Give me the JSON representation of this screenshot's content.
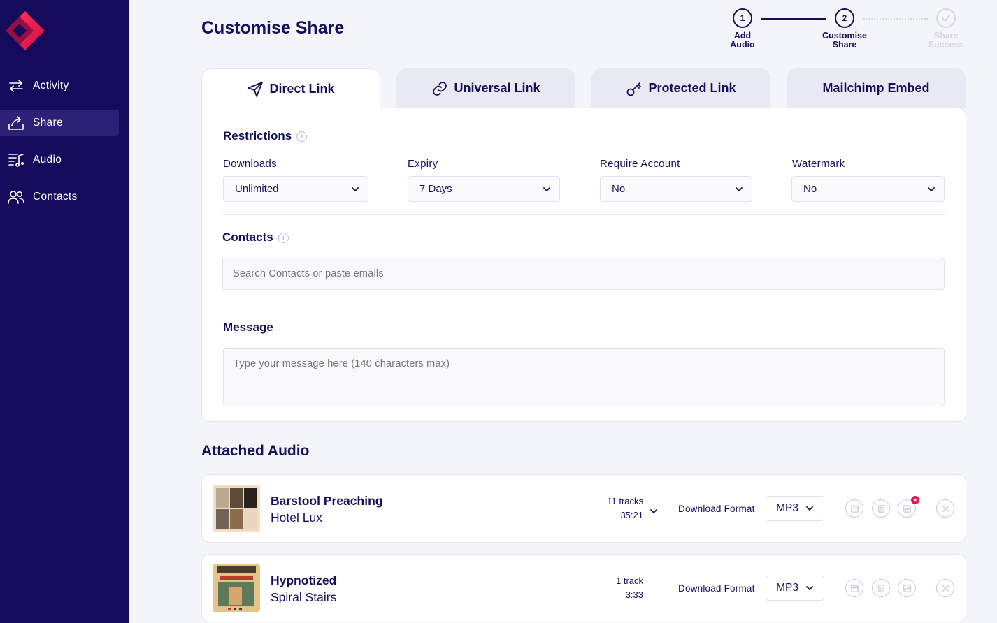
{
  "sidebar": {
    "items": [
      {
        "label": "Activity",
        "icon": "arrows-exchange-icon"
      },
      {
        "label": "Share",
        "icon": "share-tray-icon",
        "active": true
      },
      {
        "label": "Audio",
        "icon": "playlist-music-icon"
      },
      {
        "label": "Contacts",
        "icon": "users-icon"
      }
    ]
  },
  "header": {
    "title": "Customise Share"
  },
  "stepper": {
    "steps": [
      {
        "number": "1",
        "label_line1": "Add",
        "label_line2": "Audio",
        "state": "completed"
      },
      {
        "number": "2",
        "label_line1": "Customise",
        "label_line2": "Share",
        "state": "current"
      },
      {
        "number": "",
        "label_line1": "Share",
        "label_line2": "Success",
        "state": "upcoming"
      }
    ]
  },
  "tabs": [
    {
      "label": "Direct Link",
      "icon": "paper-plane-icon",
      "active": true
    },
    {
      "label": "Universal Link",
      "icon": "link-icon"
    },
    {
      "label": "Protected Link",
      "icon": "key-icon"
    },
    {
      "label": "Mailchimp Embed",
      "icon": ""
    }
  ],
  "restrictions": {
    "title": "Restrictions",
    "fields": [
      {
        "label": "Downloads",
        "value": "Unlimited"
      },
      {
        "label": "Expiry",
        "value": "7 Days"
      },
      {
        "label": "Require Account",
        "value": "No"
      },
      {
        "label": "Watermark",
        "value": "No"
      }
    ]
  },
  "contacts": {
    "title": "Contacts",
    "placeholder": "Search Contacts or paste emails"
  },
  "message": {
    "title": "Message",
    "placeholder": "Type your message here (140 characters max)"
  },
  "attached": {
    "title": "Attached Audio",
    "download_format_label": "Download Format",
    "items": [
      {
        "title": "Barstool Preaching",
        "artist": "Hotel Lux",
        "tracks": "11 tracks",
        "duration": "35:21",
        "format": "MP3",
        "expandable": true,
        "artwork_badge": true
      },
      {
        "title": "Hypnotized",
        "artist": "Spiral Stairs",
        "tracks": "1 track",
        "duration": "3:33",
        "format": "MP3",
        "expandable": false,
        "artwork_badge": false
      }
    ]
  },
  "colors": {
    "sidebar_bg": "#140b5c",
    "primary_text": "#14105e",
    "accent": "#e8174f",
    "page_bg": "#f4f5fb"
  }
}
